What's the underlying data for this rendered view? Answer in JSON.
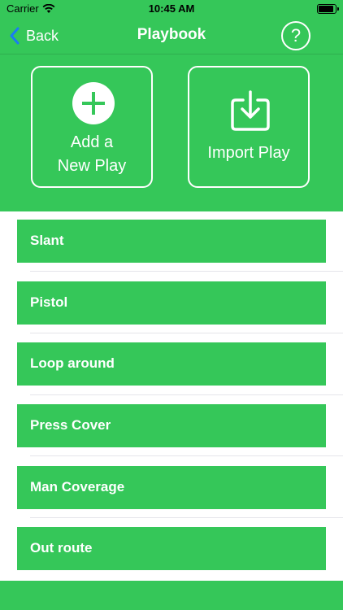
{
  "status": {
    "carrier": "Carrier",
    "time": "10:45 AM"
  },
  "nav": {
    "back_label": "Back",
    "title": "Playbook",
    "help_symbol": "?"
  },
  "actions": {
    "add_label": "Add a\nNew Play",
    "import_label": "Import Play"
  },
  "plays": [
    {
      "label": "Slant"
    },
    {
      "label": "Pistol"
    },
    {
      "label": "Loop around"
    },
    {
      "label": "Press Cover"
    },
    {
      "label": "Man Coverage"
    },
    {
      "label": "Out route"
    }
  ],
  "colors": {
    "accent": "#35c759",
    "back_chevron": "#1a7cf3"
  },
  "icons": {
    "back": "chevron-left-icon",
    "help": "question-icon",
    "add": "plus-circle-icon",
    "import": "download-tray-icon"
  }
}
